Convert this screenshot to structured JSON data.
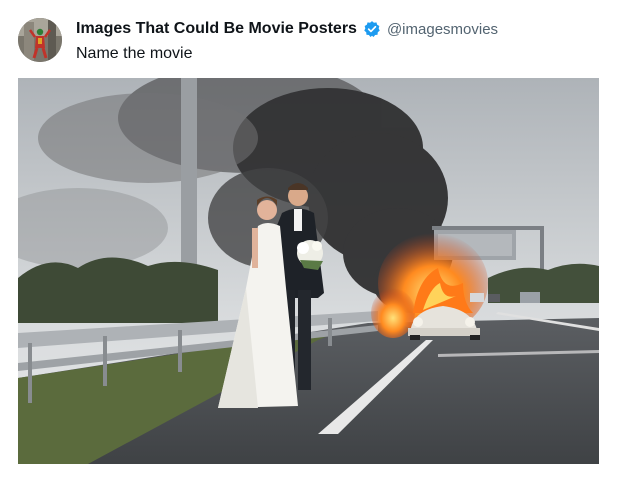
{
  "post": {
    "author": {
      "display_name": "Images That Could Be Movie Posters",
      "handle": "@imagesmovies",
      "verified": true,
      "verified_color": "#1d9bf0",
      "avatar_icon": "joker-character-avatar"
    },
    "text": "Name the movie",
    "media": {
      "kind": "photo",
      "subject": "wedding-couple-beside-burning-car",
      "visible_text": ""
    }
  }
}
